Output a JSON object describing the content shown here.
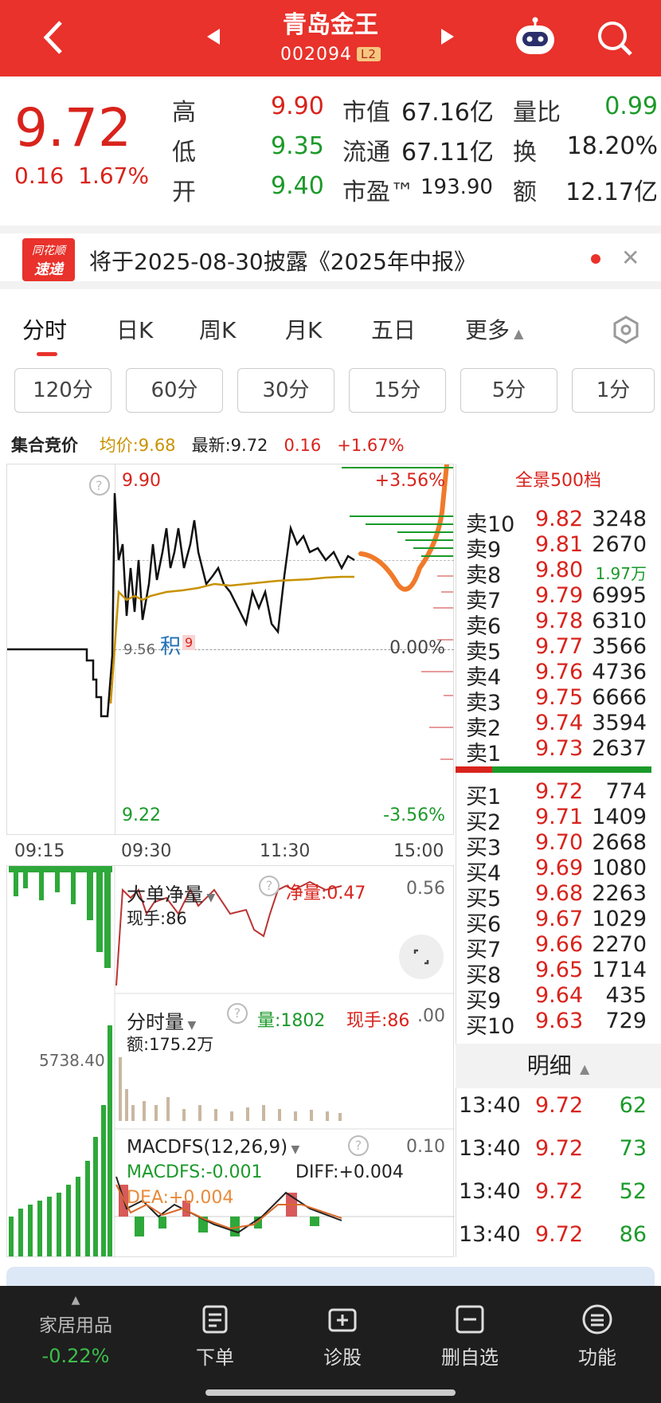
{
  "header": {
    "title": "青岛金王",
    "code": "002094",
    "level": "L2"
  },
  "quote": {
    "price": "9.72",
    "change": "0.16",
    "change_pct": "1.67%",
    "rows": [
      {
        "l1": "高",
        "v1": "9.90",
        "l2": "市值",
        "v2": "67.16亿",
        "l3": "量比",
        "v3": "0.99"
      },
      {
        "l1": "低",
        "v1": "9.35",
        "l2": "流通",
        "v2": "67.11亿",
        "l3": "换",
        "v3": "18.20%"
      },
      {
        "l1": "开",
        "v1": "9.40",
        "l2": "市盈™",
        "v2": "193.90",
        "l3": "额",
        "v3": "12.17亿"
      }
    ]
  },
  "notice": {
    "badge_top": "同花顺",
    "badge_bottom": "速递",
    "text": "将于2025-08-30披露《2025年中报》"
  },
  "tabs": [
    "分时",
    "日K",
    "周K",
    "月K",
    "五日",
    "更多"
  ],
  "periods": [
    "120分",
    "60分",
    "30分",
    "15分",
    "5分",
    "1分"
  ],
  "info": {
    "auction": "集合竞价",
    "avg": "均价:9.68",
    "latest": "最新:9.72",
    "chg": "0.16",
    "pct": "+1.67%"
  },
  "chart": {
    "high": "9.90",
    "low": "9.22",
    "pct_high": "+3.56%",
    "pct_zero": "0.00%",
    "pct_low": "-3.56%",
    "mid": "9.56",
    "ji": "积",
    "ji_num": "9",
    "times": [
      "09:15",
      "09:30",
      "11:30",
      "15:00"
    ]
  },
  "orderbook": {
    "title": "全景500档",
    "sell": [
      {
        "l": "卖10",
        "p": "9.82",
        "v": "3248"
      },
      {
        "l": "卖9",
        "p": "9.81",
        "v": "2670"
      },
      {
        "l": "卖8",
        "p": "9.80",
        "v": "1.97万"
      },
      {
        "l": "卖7",
        "p": "9.79",
        "v": "6995"
      },
      {
        "l": "卖6",
        "p": "9.78",
        "v": "6310"
      },
      {
        "l": "卖5",
        "p": "9.77",
        "v": "3566"
      },
      {
        "l": "卖4",
        "p": "9.76",
        "v": "4736"
      },
      {
        "l": "卖3",
        "p": "9.75",
        "v": "6666"
      },
      {
        "l": "卖2",
        "p": "9.74",
        "v": "3594"
      },
      {
        "l": "卖1",
        "p": "9.73",
        "v": "2637"
      }
    ],
    "buy": [
      {
        "l": "买1",
        "p": "9.72",
        "v": "774"
      },
      {
        "l": "买2",
        "p": "9.71",
        "v": "1409"
      },
      {
        "l": "买3",
        "p": "9.70",
        "v": "2668"
      },
      {
        "l": "买4",
        "p": "9.69",
        "v": "1080"
      },
      {
        "l": "买5",
        "p": "9.68",
        "v": "2263"
      },
      {
        "l": "买6",
        "p": "9.67",
        "v": "1029"
      },
      {
        "l": "买7",
        "p": "9.66",
        "v": "2270"
      },
      {
        "l": "买8",
        "p": "9.65",
        "v": "1714"
      },
      {
        "l": "买9",
        "p": "9.64",
        "v": "435"
      },
      {
        "l": "买10",
        "p": "9.63",
        "v": "729"
      }
    ]
  },
  "detail": {
    "title": "明细",
    "rows": [
      {
        "t": "13:40",
        "p": "9.72",
        "v": "62"
      },
      {
        "t": "13:40",
        "p": "9.72",
        "v": "73"
      },
      {
        "t": "13:40",
        "p": "9.72",
        "v": "52"
      },
      {
        "t": "13:40",
        "p": "9.72",
        "v": "86"
      }
    ]
  },
  "panels": {
    "netflow": {
      "title": "大单净量",
      "value": "净量:0.47",
      "hand": "现手:86",
      "right": "0.56"
    },
    "volume": {
      "title": "分时量",
      "vol": "量:1802",
      "hand": "现手:86",
      "amount": "额:175.2万",
      "right": ".00",
      "left": "5738.40"
    },
    "macd": {
      "title": "MACDFS(12,26,9)",
      "fs": "MACDFS:-0.001",
      "diff": "DIFF:+0.004",
      "dea": "DEA:+0.004",
      "right": "0.10"
    }
  },
  "bottom": {
    "sector": "家居用品",
    "sector_chg": "-0.22%",
    "buttons": [
      "下单",
      "诊股",
      "删自选",
      "功能"
    ]
  }
}
